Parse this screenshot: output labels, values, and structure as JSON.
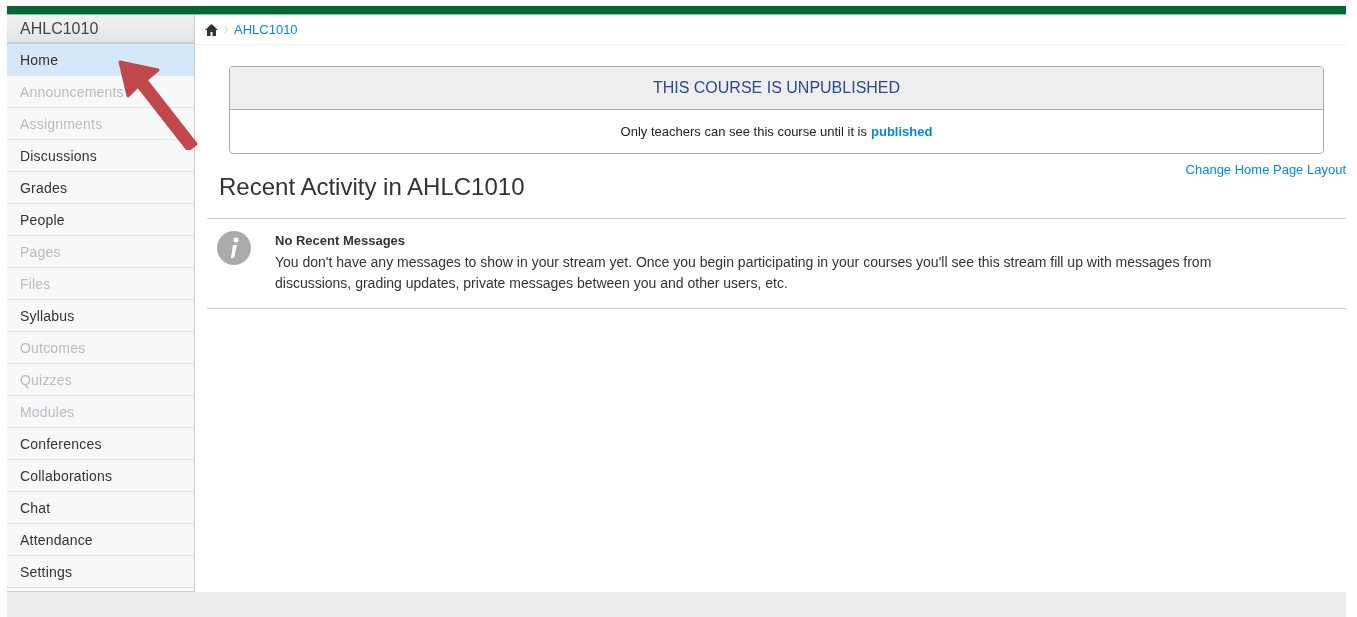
{
  "sidebar": {
    "title": "AHLC1010",
    "items": [
      {
        "label": "Home",
        "selected": true,
        "disabled": false
      },
      {
        "label": "Announcements",
        "selected": false,
        "disabled": true
      },
      {
        "label": "Assignments",
        "selected": false,
        "disabled": true
      },
      {
        "label": "Discussions",
        "selected": false,
        "disabled": false
      },
      {
        "label": "Grades",
        "selected": false,
        "disabled": false
      },
      {
        "label": "People",
        "selected": false,
        "disabled": false
      },
      {
        "label": "Pages",
        "selected": false,
        "disabled": true
      },
      {
        "label": "Files",
        "selected": false,
        "disabled": true
      },
      {
        "label": "Syllabus",
        "selected": false,
        "disabled": false
      },
      {
        "label": "Outcomes",
        "selected": false,
        "disabled": true
      },
      {
        "label": "Quizzes",
        "selected": false,
        "disabled": true
      },
      {
        "label": "Modules",
        "selected": false,
        "disabled": true
      },
      {
        "label": "Conferences",
        "selected": false,
        "disabled": false
      },
      {
        "label": "Collaborations",
        "selected": false,
        "disabled": false
      },
      {
        "label": "Chat",
        "selected": false,
        "disabled": false
      },
      {
        "label": "Attendance",
        "selected": false,
        "disabled": false
      },
      {
        "label": "Settings",
        "selected": false,
        "disabled": false
      }
    ]
  },
  "breadcrumb": {
    "items": [
      "AHLC1010"
    ]
  },
  "notice": {
    "title": "THIS COURSE IS UNPUBLISHED",
    "text": "Only teachers can see this course until it is",
    "link": "published"
  },
  "layout_link": "Change Home Page Layout",
  "heading": "Recent Activity in AHLC1010",
  "message": {
    "title": "No Recent Messages",
    "text": "You don't have any messages to show in your stream yet. Once you begin participating in your courses you'll see this stream fill up with messages from discussions, grading updates, private messages between you and other users, etc."
  }
}
